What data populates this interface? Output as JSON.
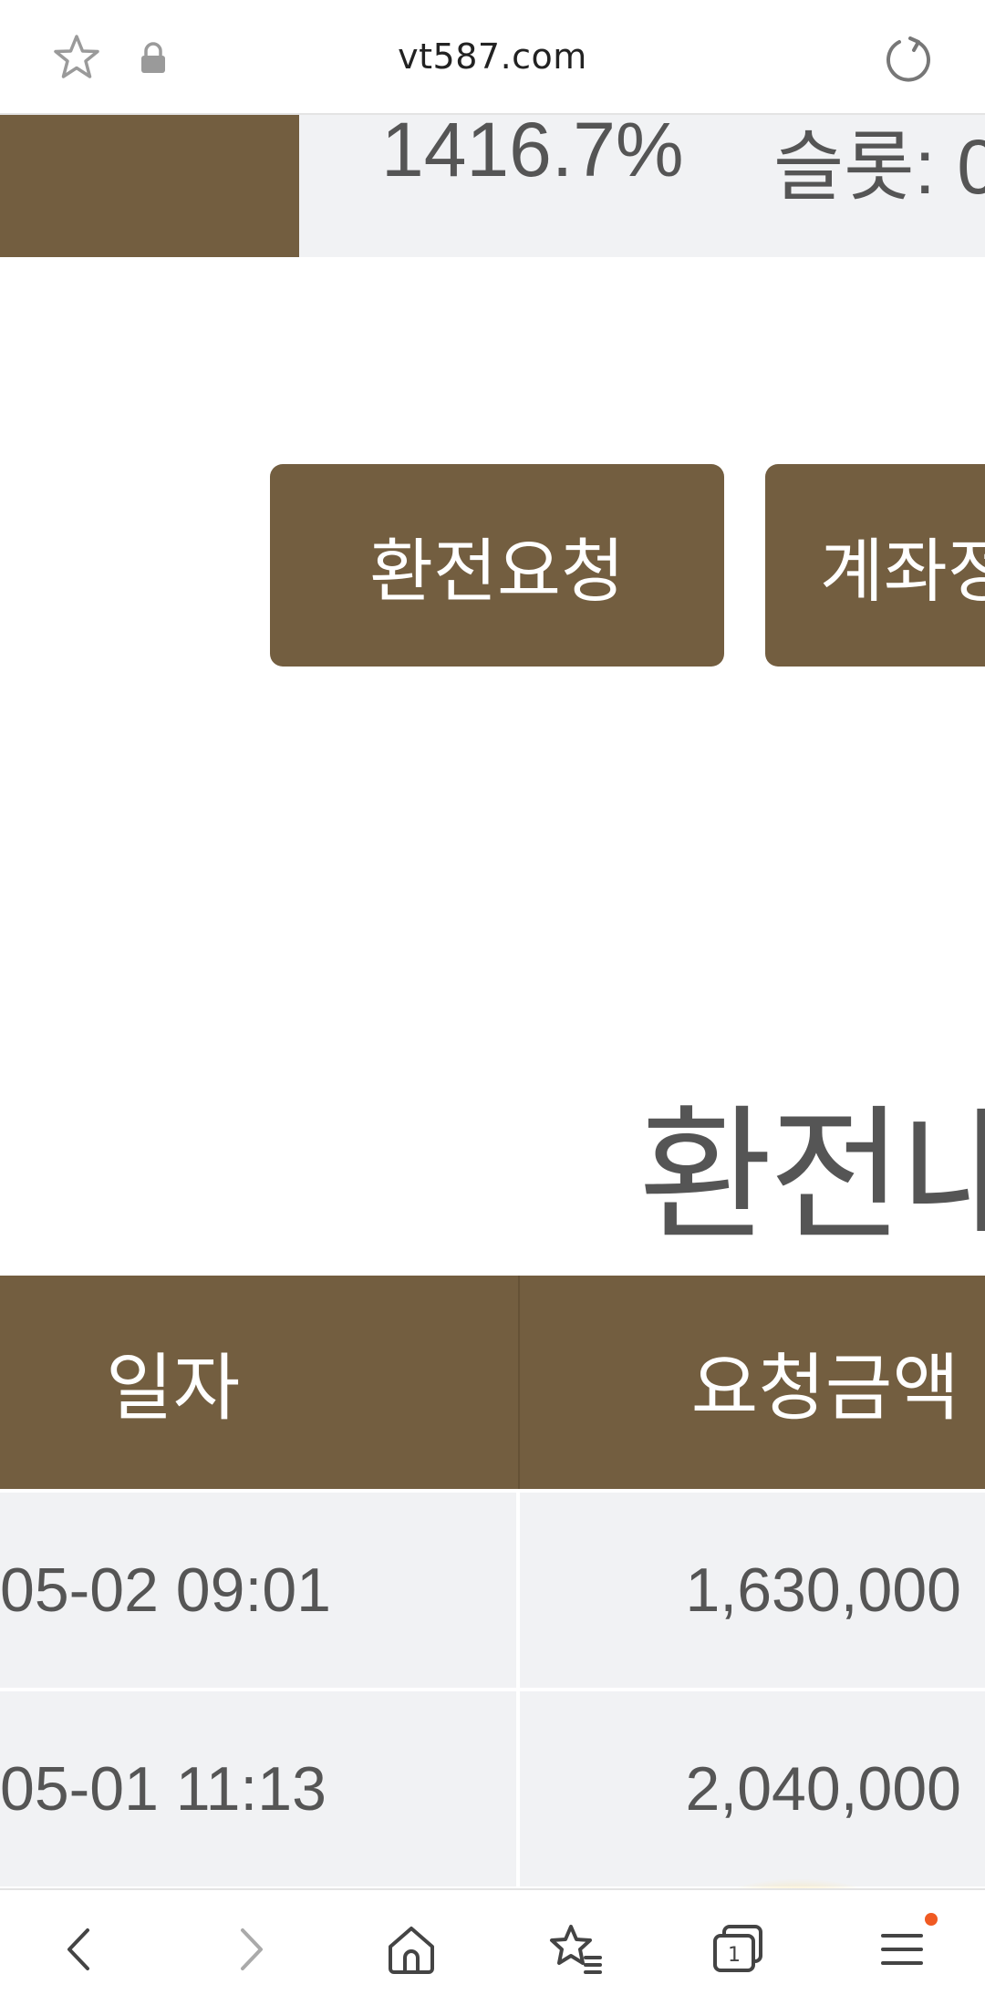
{
  "browser": {
    "url": "vt587.com",
    "icons": {
      "bookmark": "star-icon",
      "secure": "lock-icon",
      "reload": "reload-icon"
    }
  },
  "stats": {
    "rate": "1416.7%",
    "slot_label": "슬롯: 0"
  },
  "actions": {
    "exchange_label": "환전요청",
    "account_label": "계좌정"
  },
  "section": {
    "title": "환전내"
  },
  "table": {
    "headers": {
      "date": "일자",
      "amount": "요청금액"
    },
    "rows": [
      {
        "date": "05-02 09:01",
        "amount": "1,630,000"
      },
      {
        "date": "05-01 11:13",
        "amount": "2,040,000"
      }
    ]
  },
  "bottom_nav": {
    "items": [
      "back-icon",
      "forward-icon",
      "home-icon",
      "bookmarks-icon",
      "tabs-icon",
      "menu-icon"
    ],
    "tabs_count": "1"
  },
  "colors": {
    "brand_brown": "#735e40",
    "band_gray": "#f1f2f4",
    "text_gray": "#555555",
    "notification_dot": "#f05a22"
  }
}
